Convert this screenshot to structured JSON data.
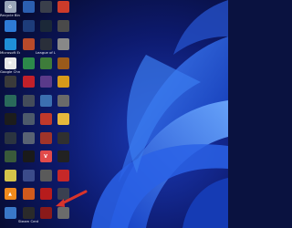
{
  "desktop": {
    "icons": [
      {
        "label": "Recycle Bin",
        "icon": "recycle-bin-icon",
        "color": "#9aa6b8",
        "glyph": "♻"
      },
      {
        "label": "",
        "icon": "app-icon",
        "color": "#2b5fb0",
        "glyph": ""
      },
      {
        "label": "",
        "icon": "app-icon",
        "color": "#3a3f4b",
        "glyph": ""
      },
      {
        "label": "",
        "icon": "app-icon",
        "color": "#cc3b2a",
        "glyph": ""
      },
      {
        "label": "",
        "icon": "app-icon",
        "color": "#2e7bd6",
        "glyph": ""
      },
      {
        "label": "",
        "icon": "app-icon",
        "color": "#1d3c7a",
        "glyph": ""
      },
      {
        "label": "",
        "icon": "steam-icon",
        "color": "#1b2838",
        "glyph": ""
      },
      {
        "label": "",
        "icon": "app-icon",
        "color": "#4a4a4a",
        "glyph": ""
      },
      {
        "label": "Microsoft Edge",
        "icon": "edge-icon",
        "color": "#1f8fd8",
        "glyph": ""
      },
      {
        "label": "",
        "icon": "app-icon",
        "color": "#b84a2a",
        "glyph": ""
      },
      {
        "label": "League of Legends",
        "icon": "league-icon",
        "color": "#2a2f3a",
        "glyph": ""
      },
      {
        "label": "",
        "icon": "app-icon",
        "color": "#888888",
        "glyph": ""
      },
      {
        "label": "Google Chrome",
        "icon": "chrome-icon",
        "color": "#e8e8e8",
        "glyph": "◉"
      },
      {
        "label": "",
        "icon": "app-icon",
        "color": "#2c8a4a",
        "glyph": ""
      },
      {
        "label": "",
        "icon": "app-icon",
        "color": "#3e7c3a",
        "glyph": ""
      },
      {
        "label": "",
        "icon": "app-icon",
        "color": "#9a5a1a",
        "glyph": ""
      },
      {
        "label": "",
        "icon": "app-icon",
        "color": "#3a3a3a",
        "glyph": ""
      },
      {
        "label": "",
        "icon": "app-icon",
        "color": "#c2202a",
        "glyph": ""
      },
      {
        "label": "",
        "icon": "app-icon",
        "color": "#5a3a8a",
        "glyph": ""
      },
      {
        "label": "",
        "icon": "app-icon",
        "color": "#d79a1a",
        "glyph": ""
      },
      {
        "label": "",
        "icon": "app-icon",
        "color": "#2a6a5a",
        "glyph": ""
      },
      {
        "label": "",
        "icon": "app-icon",
        "color": "#444c5a",
        "glyph": ""
      },
      {
        "label": "",
        "icon": "app-icon",
        "color": "#3b6fb0",
        "glyph": ""
      },
      {
        "label": "",
        "icon": "app-icon",
        "color": "#6a6a6a",
        "glyph": ""
      },
      {
        "label": "",
        "icon": "app-icon",
        "color": "#1c1c1c",
        "glyph": ""
      },
      {
        "label": "",
        "icon": "app-icon",
        "color": "#4d5a6b",
        "glyph": ""
      },
      {
        "label": "",
        "icon": "app-icon",
        "color": "#c0392b",
        "glyph": ""
      },
      {
        "label": "",
        "icon": "folder-icon",
        "color": "#e6b73c",
        "glyph": ""
      },
      {
        "label": "",
        "icon": "app-icon",
        "color": "#2b3440",
        "glyph": ""
      },
      {
        "label": "",
        "icon": "app-icon",
        "color": "#596273",
        "glyph": ""
      },
      {
        "label": "",
        "icon": "app-icon",
        "color": "#a0342a",
        "glyph": ""
      },
      {
        "label": "",
        "icon": "app-icon",
        "color": "#303030",
        "glyph": ""
      },
      {
        "label": "",
        "icon": "app-icon",
        "color": "#3a5a3a",
        "glyph": ""
      },
      {
        "label": "",
        "icon": "app-icon",
        "color": "#1a1a1a",
        "glyph": ""
      },
      {
        "label": "",
        "icon": "valorant-icon",
        "color": "#e24a4a",
        "glyph": "V"
      },
      {
        "label": "",
        "icon": "app-icon",
        "color": "#222222",
        "glyph": ""
      },
      {
        "label": "",
        "icon": "app-icon",
        "color": "#d4c44a",
        "glyph": ""
      },
      {
        "label": "",
        "icon": "app-icon",
        "color": "#3b4b8a",
        "glyph": ""
      },
      {
        "label": "",
        "icon": "app-icon",
        "color": "#5a5a5a",
        "glyph": ""
      },
      {
        "label": "",
        "icon": "app-icon",
        "color": "#c62828",
        "glyph": ""
      },
      {
        "label": "",
        "icon": "vlc-icon",
        "color": "#f08a1c",
        "glyph": "▲"
      },
      {
        "label": "",
        "icon": "app-icon",
        "color": "#d15a1c",
        "glyph": ""
      },
      {
        "label": "",
        "icon": "app-icon",
        "color": "#b71c1c",
        "glyph": ""
      },
      {
        "label": "",
        "icon": "app-icon",
        "color": "#3a4050",
        "glyph": ""
      },
      {
        "label": "",
        "icon": "app-icon",
        "color": "#3a78c8",
        "glyph": ""
      },
      {
        "label": "Steam Center",
        "icon": "app-icon",
        "color": "#2a2a2a",
        "glyph": ""
      },
      {
        "label": "",
        "icon": "app-icon",
        "color": "#8a1a1a",
        "glyph": ""
      },
      {
        "label": "",
        "icon": "app-icon",
        "color": "#6b6b6b",
        "glyph": ""
      }
    ]
  },
  "annotation": {
    "color": "#d9342b"
  }
}
